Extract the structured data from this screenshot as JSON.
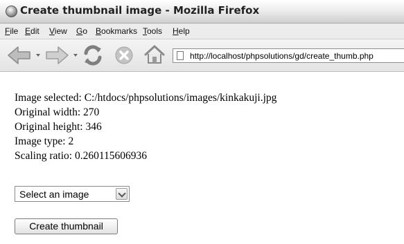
{
  "window": {
    "title": "Create thumbnail image - Mozilla Firefox"
  },
  "menu": {
    "items": [
      {
        "underline": "F",
        "rest": "ile"
      },
      {
        "underline": "E",
        "rest": "dit"
      },
      {
        "underline": "V",
        "rest": "iew"
      },
      {
        "underline": "G",
        "rest": "o"
      },
      {
        "underline": "B",
        "rest": "ookmarks"
      },
      {
        "underline": "T",
        "rest": "ools"
      },
      {
        "underline": "H",
        "rest": "elp"
      }
    ]
  },
  "toolbar": {
    "icons": [
      "back-arrow-icon",
      "forward-arrow-icon",
      "reload-icon",
      "stop-icon",
      "home-icon",
      "page-icon"
    ],
    "url": "http://localhost/phpsolutions/gd/create_thumb.php"
  },
  "content": {
    "image_selected": "Image selected: C:/htdocs/phpsolutions/images/kinkakuji.jpg",
    "original_width": "Original width: 270",
    "original_height": "Original height: 346",
    "image_type": "Image type: 2",
    "scaling_ratio": "Scaling ratio: 0.260115606936"
  },
  "form": {
    "select_value": "Select an image",
    "submit_label": "Create thumbnail"
  },
  "colors": {
    "titlebar_bg": "#e6e6e6",
    "icon_gray": "#8c8c8c",
    "stop_icon_gray": "#b8b8b8"
  }
}
